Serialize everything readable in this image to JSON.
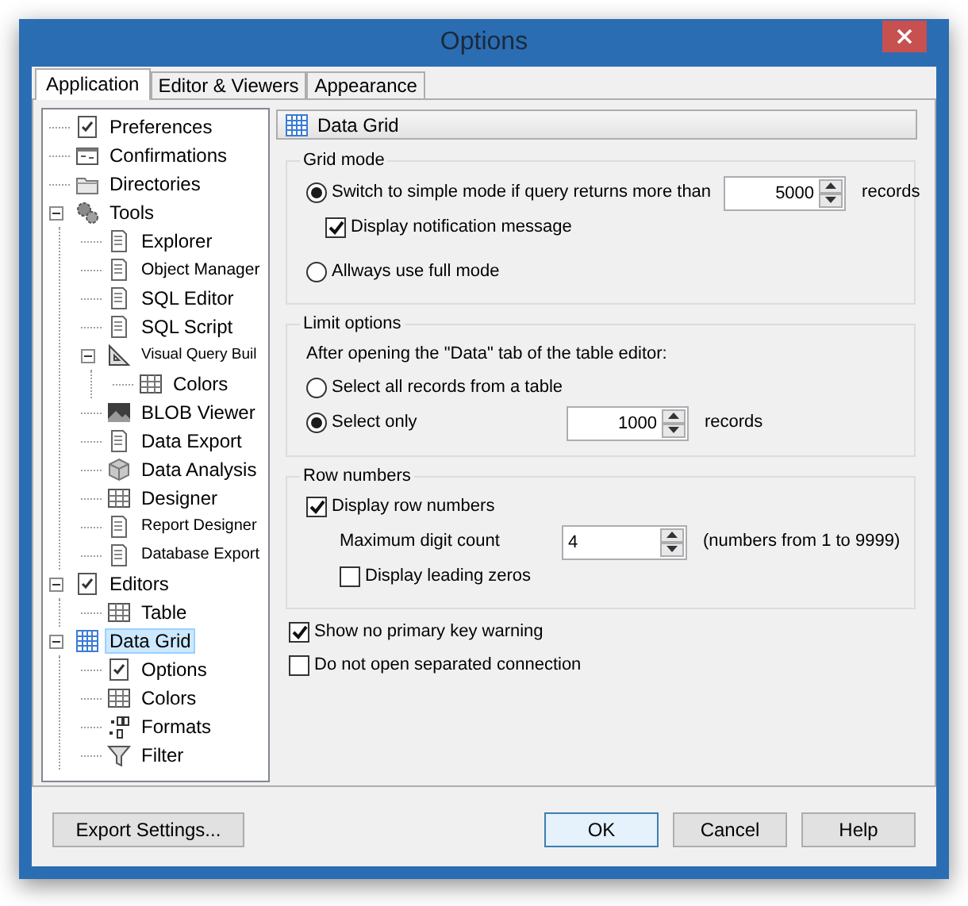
{
  "window": {
    "title": "Options"
  },
  "tabs": [
    {
      "label": "Application",
      "selected": true
    },
    {
      "label": "Editor & Viewers",
      "selected": false
    },
    {
      "label": "Appearance",
      "selected": false
    }
  ],
  "tree": [
    {
      "label": "Preferences",
      "selected": false
    },
    {
      "label": "Confirmations",
      "selected": false
    },
    {
      "label": "Directories",
      "selected": false
    },
    {
      "label": "Tools",
      "selected": false,
      "expanded": true,
      "children": [
        {
          "label": "Explorer",
          "selected": false
        },
        {
          "label": "Object Manager",
          "selected": false
        },
        {
          "label": "SQL Editor",
          "selected": false
        },
        {
          "label": "SQL Script",
          "selected": false
        },
        {
          "label": "Visual Query Buil",
          "selected": false,
          "expanded": true,
          "children": [
            {
              "label": "Colors",
              "selected": false
            }
          ]
        },
        {
          "label": "BLOB Viewer",
          "selected": false
        },
        {
          "label": "Data Export",
          "selected": false
        },
        {
          "label": "Data Analysis",
          "selected": false
        },
        {
          "label": "Designer",
          "selected": false
        },
        {
          "label": "Report Designer",
          "selected": false
        },
        {
          "label": "Database Export",
          "selected": false
        }
      ]
    },
    {
      "label": "Editors",
      "selected": false,
      "expanded": true,
      "children": [
        {
          "label": "Table",
          "selected": false
        }
      ]
    },
    {
      "label": "Data Grid",
      "selected": true,
      "expanded": true,
      "children": [
        {
          "label": "Options",
          "selected": false
        },
        {
          "label": "Colors",
          "selected": false
        },
        {
          "label": "Formats",
          "selected": false
        },
        {
          "label": "Filter",
          "selected": false
        }
      ]
    }
  ],
  "panel": {
    "title": "Data Grid",
    "groups": [
      {
        "title": "Grid mode",
        "rows": [
          {
            "kind": "radio",
            "label": "Switch to simple mode if query returns more than",
            "selected": true,
            "spin": "5000",
            "suffix": "records",
            "children": [
              {
                "kind": "checkbox",
                "label": "Display notification message",
                "checked": true
              }
            ]
          },
          {
            "kind": "radio",
            "label": "Allways use full mode",
            "selected": false
          }
        ]
      },
      {
        "title": "Limit options",
        "rows": [
          {
            "kind": "text",
            "label": "After opening the \"Data\" tab of the table editor:"
          },
          {
            "kind": "radio",
            "label": "Select all records from a table",
            "selected": false
          },
          {
            "kind": "radio",
            "label": "Select only",
            "selected": true,
            "spin": "1000",
            "suffix": "records"
          }
        ]
      },
      {
        "title": "Row numbers",
        "rows": [
          {
            "kind": "checkbox",
            "label": "Display row numbers",
            "checked": true,
            "children": [
              {
                "kind": "spin",
                "label": "Maximum digit count",
                "spin": "4",
                "suffix": "(numbers from 1 to 9999)"
              },
              {
                "kind": "checkbox",
                "label": "Display leading zeros",
                "checked": false
              }
            ]
          }
        ]
      }
    ],
    "rows": [
      {
        "kind": "checkbox",
        "label": "Show no primary key warning",
        "checked": true
      },
      {
        "kind": "checkbox",
        "label": "Do not open separated connection",
        "checked": false
      }
    ]
  },
  "left_buttons": [
    {
      "label": "Export Settings...",
      "default": false
    }
  ],
  "right_buttons": [
    {
      "label": "OK",
      "default": true
    },
    {
      "label": "Cancel",
      "default": false
    },
    {
      "label": "Help",
      "default": false
    }
  ]
}
